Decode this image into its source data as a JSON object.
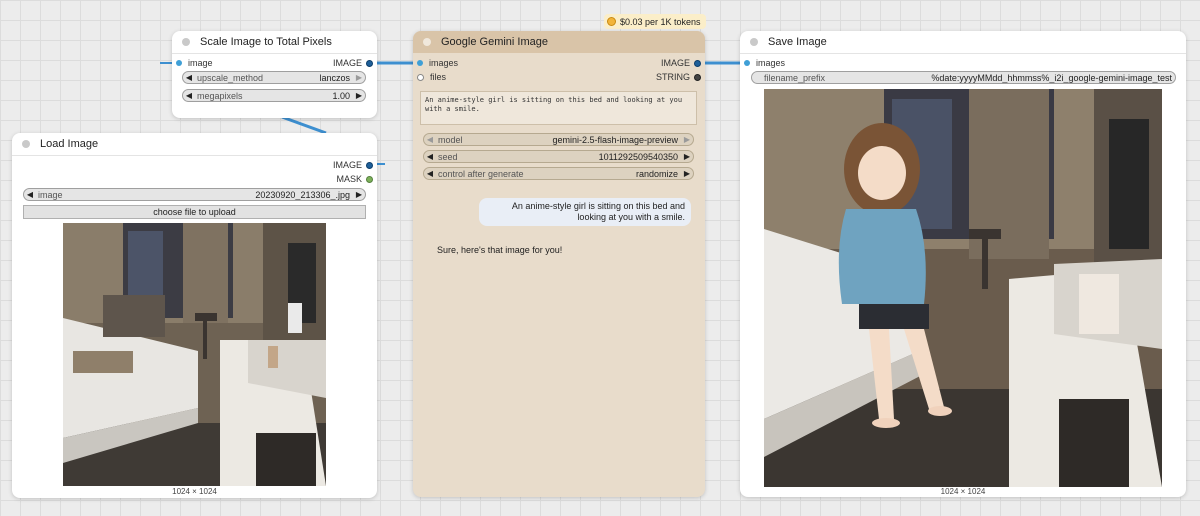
{
  "cost_badge": "$0.03 per 1K tokens",
  "scale_node": {
    "title": "Scale Image to Total Pixels",
    "input": "image",
    "output": "IMAGE",
    "widgets": [
      {
        "label": "upscale_method",
        "value": "lanczos"
      },
      {
        "label": "megapixels",
        "value": "1.00"
      }
    ]
  },
  "load_node": {
    "title": "Load Image",
    "outputs": [
      "IMAGE",
      "MASK"
    ],
    "image_widget": {
      "label": "image",
      "value": "20230920_213306_.jpg"
    },
    "upload_button": "choose file to upload",
    "dimensions": "1024 × 1024"
  },
  "gemini_node": {
    "title": "Google Gemini Image",
    "inputs": [
      "images",
      "files"
    ],
    "outputs": [
      "IMAGE",
      "STRING"
    ],
    "prompt": "An anime-style girl is sitting on this bed and looking at you with a smile.",
    "widgets": [
      {
        "label": "model",
        "value": "gemini-2.5-flash-image-preview"
      },
      {
        "label": "seed",
        "value": "1011292509540350"
      },
      {
        "label": "control after generate",
        "value": "randomize"
      }
    ],
    "chat_user": "An anime-style girl is sitting on this bed and looking at you with a smile.",
    "chat_reply": "Sure, here's that image for you!"
  },
  "save_node": {
    "title": "Save Image",
    "input": "images",
    "filename_widget": {
      "label": "filename_prefix",
      "value": "%date:yyyyMMdd_hhmmss%_i2i_google-gemini-image_test"
    },
    "dimensions": "1024 × 1024"
  },
  "colors": {
    "link": "#3d8fd0",
    "gemini_bg": "#e8dccb",
    "gemini_header": "#d9c4a8",
    "image_slot": "#3f9fd6",
    "mask_slot": "#7db15a"
  }
}
